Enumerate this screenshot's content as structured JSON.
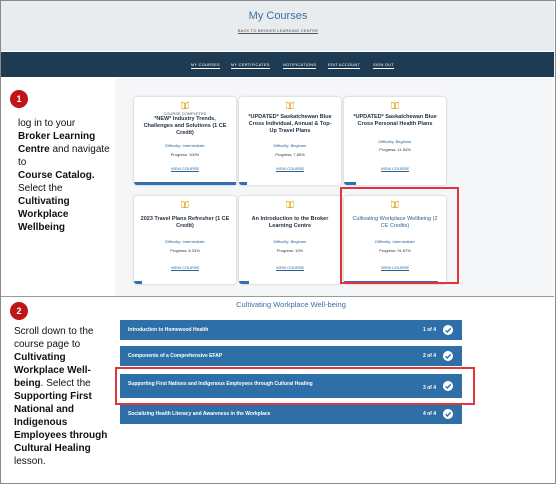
{
  "header": {
    "title": "My Courses",
    "back_link": "BACK TO BROKER LEARNING CENTRE"
  },
  "nav": {
    "items": [
      "MY COURSES",
      "MY CERTIFICATES",
      "NOTIFICATIONS",
      "EDIT ACCOUNT",
      "SIGN OUT"
    ]
  },
  "step1": {
    "badge": "1",
    "text_1": "log in to your",
    "text_2": "Broker Learning Centre",
    "text_3": " and navigate to",
    "text_4": "Course Catalog.",
    "text_5": " Select the",
    "text_6": "Cultivating Workplace Wellbeing"
  },
  "courses": [
    {
      "status": "COURSE COMPLETED",
      "title": "*NEW* Industry Trends, Challenges and Solutions (1 CE Credit)",
      "difficulty": "Difficulty: Intermediate",
      "progress": "Progress: 100%",
      "progress_value": 100,
      "view": "VIEW COURSE"
    },
    {
      "status": "",
      "title": "*UPDATED* Saskatchewan Blue Cross Individual, Annual & Top-Up Travel Plans",
      "difficulty": "Difficulty: Beginner",
      "progress": "Progress: 7.85%",
      "progress_value": 7.85,
      "view": "VIEW COURSE"
    },
    {
      "status": "",
      "title": "*UPDATED* Saskatchewan Blue Cross Personal Health Plans",
      "difficulty": "Difficulty: Beginner",
      "progress": "Progress: 11.54%",
      "progress_value": 11.54,
      "view": "VIEW COURSE"
    },
    {
      "status": "",
      "title": "2023 Travel Plans Refresher (1 CE Credit)",
      "difficulty": "Difficulty: Intermediate",
      "progress": "Progress: 8.33%",
      "progress_value": 8.33,
      "view": "VIEW COURSE"
    },
    {
      "status": "",
      "title": "An Introduction to the Broker Learning Centre",
      "difficulty": "Difficulty: Beginner",
      "progress": "Progress: 10%",
      "progress_value": 10,
      "view": "VIEW COURSE"
    },
    {
      "status": "",
      "title": "Cultivating Workplace Wellbeing (2 CE Credits)",
      "difficulty": "Difficulty: Intermediate",
      "progress": "Progress: 91.67%",
      "progress_value": 91.67,
      "view": "VIEW COURSE"
    }
  ],
  "step2": {
    "badge": "2",
    "text_1": "Scroll down to the course page to",
    "text_2": "Cultivating Workplace Well-being",
    "text_3": ". Select the",
    "text_4": "Supporting First National and Indigenous Employees through Cultural Healing",
    "text_5": " lesson."
  },
  "course_page": {
    "title": "Cultivating Workplace Well-being",
    "lessons": [
      {
        "name": "Introduction to Homewood Health",
        "count": "1 of 4"
      },
      {
        "name": "Components of a Comprehensive EFAP",
        "count": "2 of 4"
      },
      {
        "name": "Supporting First Nations and Indigenous Employees through Cultural Healing",
        "count": "3 of 4"
      },
      {
        "name": "Socializing Health Literacy and Awareness in the Workplace",
        "count": "4 of 4"
      }
    ]
  },
  "colors": {
    "navbar": "#1e3b54",
    "accent_blue": "#2e6fa8",
    "highlight_red": "#e0353a",
    "badge_red": "#c0131a"
  },
  "icons": [
    "book-icon",
    "checkmark-icon"
  ]
}
